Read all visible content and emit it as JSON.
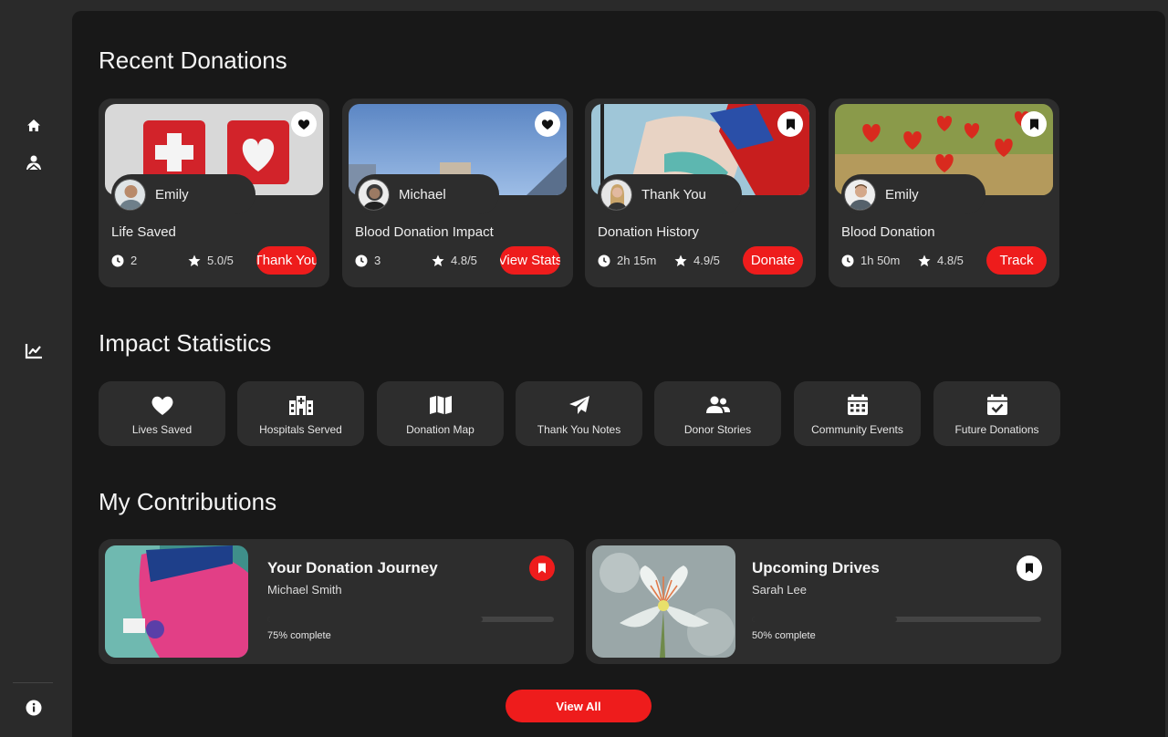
{
  "colors": {
    "accent": "#ee1c1c",
    "panel": "#181818",
    "card": "#2d2d2d",
    "sidebar": "#2a2a2a"
  },
  "sidebar": {
    "items": [
      {
        "icon": "home-icon"
      },
      {
        "icon": "donor-icon"
      },
      {
        "icon": "chart-icon"
      },
      {
        "icon": "info-icon"
      }
    ]
  },
  "recent": {
    "title": "Recent Donations",
    "cards": [
      {
        "user": "Emily",
        "title": "Life Saved",
        "meta1": "2",
        "rating": "5.0/5",
        "button": "Thank You",
        "fav_icon": "heart-icon"
      },
      {
        "user": "Michael",
        "title": "Blood Donation Impact",
        "meta1": "3",
        "rating": "4.8/5",
        "button": "View Stats",
        "fav_icon": "heart-icon"
      },
      {
        "user": "Thank You",
        "title": "Donation History",
        "meta1": "2h 15m",
        "rating": "4.9/5",
        "button": "Donate",
        "fav_icon": "bookmark-icon"
      },
      {
        "user": "Emily",
        "title": "Blood Donation",
        "meta1": "1h 50m",
        "rating": "4.8/5",
        "button": "Track",
        "fav_icon": "bookmark-icon"
      }
    ]
  },
  "stats": {
    "title": "Impact Statistics",
    "items": [
      {
        "label": "Lives Saved",
        "icon": "heart-icon"
      },
      {
        "label": "Hospitals Served",
        "icon": "hospital-icon"
      },
      {
        "label": "Donation Map",
        "icon": "map-icon"
      },
      {
        "label": "Thank You Notes",
        "icon": "paper-plane-icon"
      },
      {
        "label": "Donor Stories",
        "icon": "users-icon"
      },
      {
        "label": "Community Events",
        "icon": "calendar-icon"
      },
      {
        "label": "Future Donations",
        "icon": "calendar-check-icon"
      }
    ]
  },
  "contributions": {
    "title": "My Contributions",
    "items": [
      {
        "title": "Your Donation Journey",
        "subtitle": "Michael Smith",
        "progress_text": "75% complete",
        "progress": 0.75,
        "bookmark_active": true
      },
      {
        "title": "Upcoming Drives",
        "subtitle": "Sarah Lee",
        "progress_text": "50% complete",
        "progress": 0.5,
        "bookmark_active": false
      }
    ]
  },
  "view_all_label": "View All"
}
